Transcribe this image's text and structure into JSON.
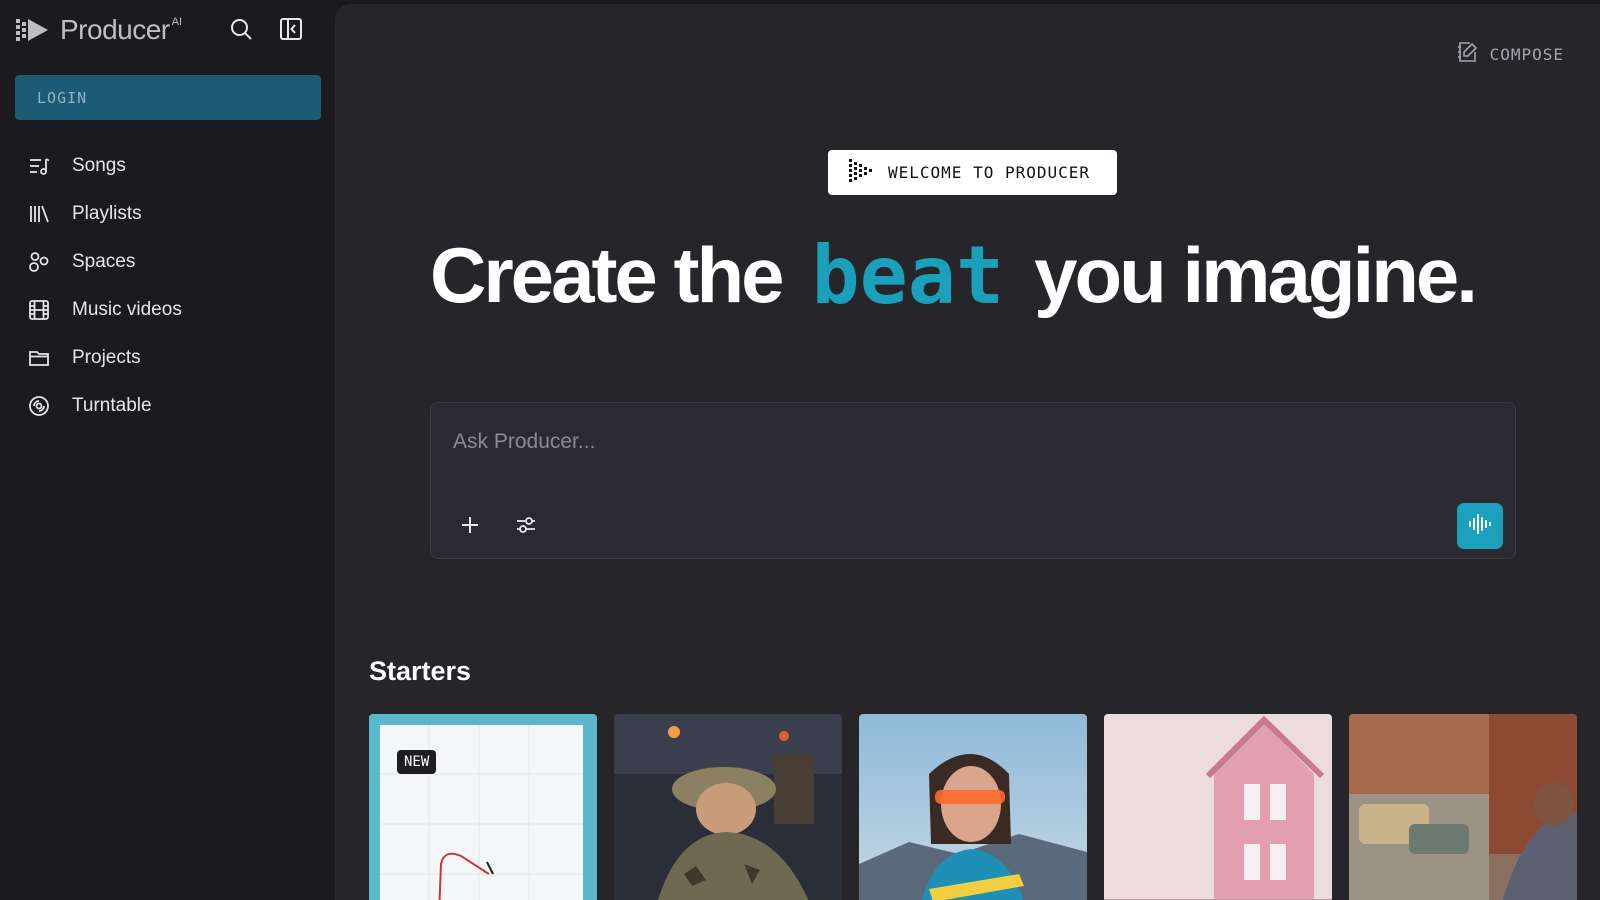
{
  "app": {
    "name": "Producer",
    "superscript": "AI",
    "logo_icon": "producer-logo-icon"
  },
  "header": {
    "search_icon": "search-icon",
    "collapse_icon": "sidebar-collapse-icon"
  },
  "sidebar": {
    "login_label": "LOGIN",
    "items": [
      {
        "label": "Songs",
        "icon": "songs-list-icon"
      },
      {
        "label": "Playlists",
        "icon": "library-icon"
      },
      {
        "label": "Spaces",
        "icon": "spaces-icon"
      },
      {
        "label": "Music videos",
        "icon": "film-icon"
      },
      {
        "label": "Projects",
        "icon": "folder-icon"
      },
      {
        "label": "Turntable",
        "icon": "turntable-icon"
      }
    ]
  },
  "main": {
    "compose_label": "COMPOSE",
    "welcome_label": "WELCOME TO PRODUCER",
    "headline": {
      "before": "Create the",
      "accent": "beat",
      "after": "you imagine."
    },
    "prompt": {
      "placeholder": "Ask Producer...",
      "add_icon": "plus-icon",
      "settings_icon": "sliders-icon",
      "voice_icon": "waveform-icon"
    },
    "starters_title": "Starters",
    "starters": [
      {
        "badge": "NEW",
        "image": "sketch-drawing-card"
      },
      {
        "image": "bucket-hat-dj-photo"
      },
      {
        "image": "woman-neon-glasses-photo"
      },
      {
        "image": "pink-victorian-house-photo"
      },
      {
        "image": "street-vintage-cars-photo"
      }
    ]
  },
  "colors": {
    "accent": "#1aa0bb",
    "login_bg": "#1b5b73",
    "sidebar_bg": "#1b1b1f",
    "main_bg": "#25252a"
  }
}
